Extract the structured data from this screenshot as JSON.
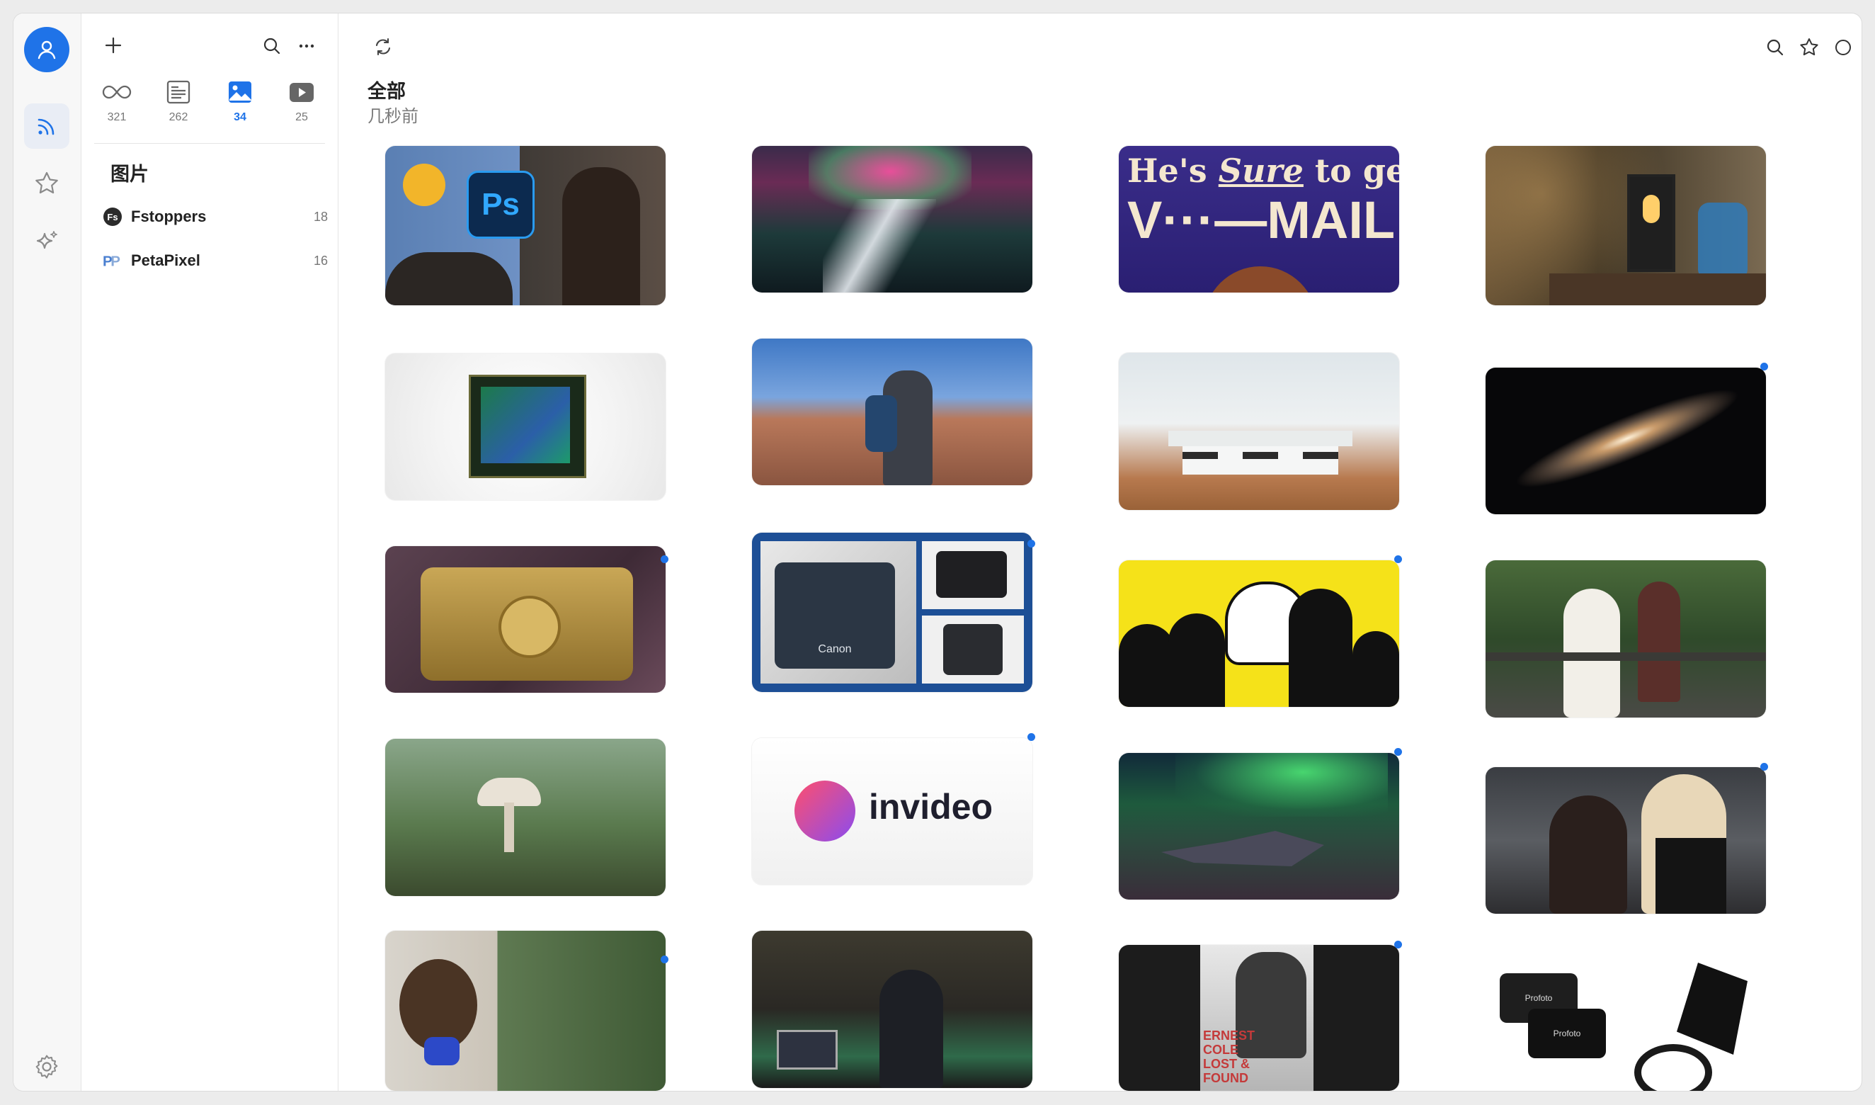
{
  "filters": [
    {
      "icon": "infinity-icon",
      "count": "321"
    },
    {
      "icon": "article-icon",
      "count": "262"
    },
    {
      "icon": "image-icon",
      "count": "34"
    },
    {
      "icon": "video-icon",
      "count": "25"
    }
  ],
  "sidebar": {
    "section_title": "图片",
    "feeds": [
      {
        "name": "Fstoppers",
        "count": "18",
        "logo_text": "Fs"
      },
      {
        "name": "PetaPixel",
        "count": "16",
        "logo_text": "PP"
      }
    ]
  },
  "main": {
    "title": "全部",
    "subtitle": "几秒前"
  },
  "images": {
    "vmail_text": "He's Sure to get V···—MAIL",
    "vmail_line1": "He's",
    "vmail_sure": "Sure",
    "vmail_line1b": "to get",
    "vmail_line2": "V···—MAIL",
    "ps_text": "Ps",
    "canon_text": "Canon",
    "invideo_text": "invideo",
    "book_text": "ERNEST COLE LOST & FOUND",
    "book_l1": "ERNEST",
    "book_l2": "COLE",
    "book_l3": "LOST &",
    "book_l4": "FOUND",
    "profoto_text": "Profoto"
  },
  "colors": {
    "accent": "#1f73e8",
    "unread_dot": "#1f73e8"
  }
}
